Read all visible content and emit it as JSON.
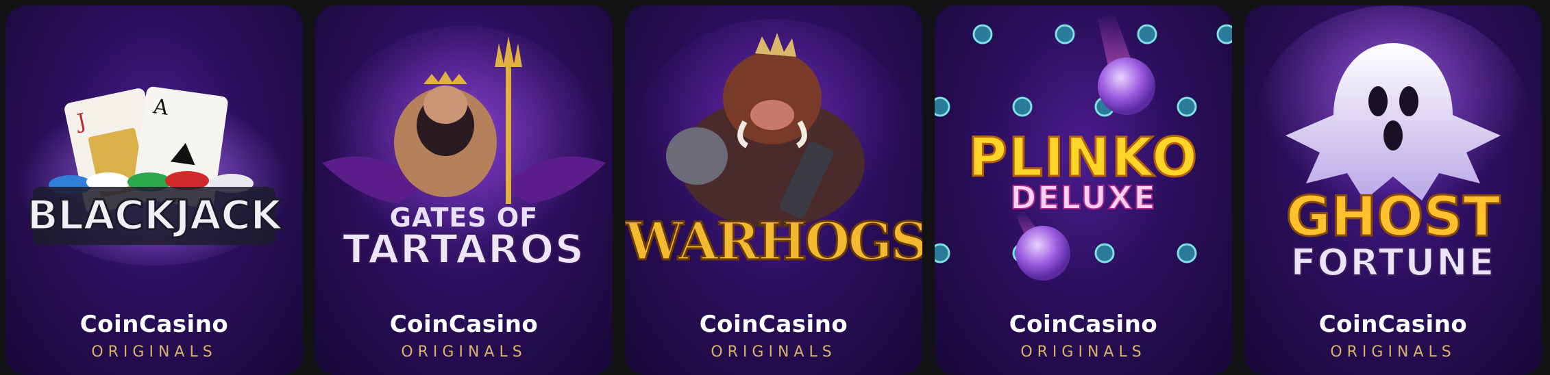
{
  "cards": [
    {
      "title_lines": [
        "BLACKJACK"
      ],
      "brand": "CoinCasino",
      "label": "ORIGINALS"
    },
    {
      "title_lines": [
        "GATES OF",
        "TARTAROS"
      ],
      "brand": "CoinCasino",
      "label": "ORIGINALS"
    },
    {
      "title_lines": [
        "WARHOGS"
      ],
      "brand": "CoinCasino",
      "label": "ORIGINALS"
    },
    {
      "title_lines": [
        "PLINKO",
        "DELUXE"
      ],
      "brand": "CoinCasino",
      "label": "ORIGINALS"
    },
    {
      "title_lines": [
        "GHOST",
        "FORTUNE"
      ],
      "brand": "CoinCasino",
      "label": "ORIGINALS"
    }
  ],
  "colors": {
    "page_bg": "#121214",
    "card_bg": "#2b0f5c",
    "brand_text": "#ffffff",
    "label_text": "#d9b26a"
  }
}
